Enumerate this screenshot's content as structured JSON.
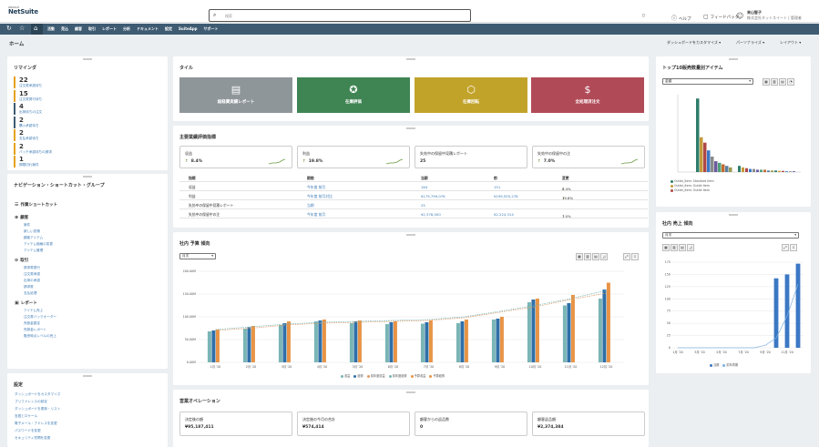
{
  "topbar": {
    "logo_small": "ORACLE",
    "logo": "NetSuite",
    "search_placeholder": "検索",
    "help": "ヘルプ",
    "feedback": "フィードバック",
    "user_name": "来山智子",
    "user_role": "株式会社ネットスイート | 管理者"
  },
  "nav": {
    "items": [
      "活動",
      "見込",
      "顧客",
      "取引",
      "レポート",
      "分析",
      "ドキュメント",
      "設定",
      "SuiteApp",
      "サポート"
    ]
  },
  "page": {
    "title": "ホーム",
    "controls": [
      "ダッシュボードをカスタマイズ",
      "パーソナライズ",
      "レイアウト"
    ]
  },
  "reminders": {
    "title": "リマインダ",
    "items": [
      {
        "count": "22",
        "label": "注文書承認待ち",
        "color": "orange"
      },
      {
        "count": "15",
        "label": "注文書発行待ち",
        "color": "orange"
      },
      {
        "count": "4",
        "label": "出荷待ちの注文",
        "color": "blue"
      },
      {
        "count": "2",
        "label": "購入承認待ち",
        "color": "blue"
      },
      {
        "count": "2",
        "label": "支払承認待ち",
        "color": "orange"
      },
      {
        "count": "2",
        "label": "バッチ承認待ちの請求",
        "color": "orange"
      },
      {
        "count": "1",
        "label": "期限切れ案件",
        "color": "orange"
      }
    ]
  },
  "navgroup": {
    "title": "ナビゲーション・ショートカット・グループ",
    "header": "作業ショートカット",
    "sections": [
      {
        "label": "顧客",
        "links": [
          "案件",
          "新しい見積",
          "顧客アイテム",
          "アイテム価格の変更",
          "アイテム管理"
        ]
      },
      {
        "label": "取引",
        "links": [
          "請求書発行",
          "注文書承認",
          "出荷の承認",
          "請求書",
          "支払処理"
        ]
      },
      {
        "label": "レポート",
        "links": [
          "アイテム売上",
          "注文書バックオーダー",
          "売掛金勘定",
          "売掛金レポート",
          "販売時点レベルの売上"
        ]
      }
    ]
  },
  "settings": {
    "title": "設定",
    "links": [
      "ダッシュボードをカスタマイズ",
      "プリファレンスの設定",
      "ダッシュボードを更新・リスト",
      "言語とロケール",
      "電子メール・アドレスを変更",
      "パスワードを変更",
      "セキュリティ質問を変更"
    ]
  },
  "tiles": {
    "title": "タイル",
    "items": [
      {
        "label": "総経費実績レポート",
        "color": "#8f969a"
      },
      {
        "label": "在庫評価",
        "color": "#3f8554"
      },
      {
        "label": "在庫回転",
        "color": "#c2a32a"
      },
      {
        "label": "全処理済注文",
        "color": "#b14a57"
      }
    ]
  },
  "kpis": {
    "title": "主要業績評価指標",
    "cards": [
      {
        "label": "収益",
        "value": "8.4%"
      },
      {
        "label": "利益",
        "value": "19.8%"
      },
      {
        "label": "失効中の保留中見積レポート",
        "value": "25"
      },
      {
        "label": "失効中の保留中の注",
        "value": "7.0%"
      }
    ],
    "columns": [
      "指標",
      "期間",
      "当期",
      "前",
      "変更"
    ],
    "rows": [
      {
        "name": "収益",
        "period": "今年度 前月",
        "cur": "164",
        "prev": "151",
        "change": "8.4%",
        "arrow": "↑"
      },
      {
        "name": "利益",
        "period": "今年度 前月対比",
        "cur": "¥179,799,076",
        "prev": "¥199,555,278",
        "change": "19.8%",
        "arrow": "↑"
      },
      {
        "name": "失効中の保留中見積レポート",
        "period": "当期",
        "cur": "25",
        "prev": "",
        "change": "",
        "arrow": ""
      },
      {
        "name": "失効中の保留中の注",
        "period": "今年度 前月",
        "cur": "¥2,378,000",
        "prev": "¥2,224,314",
        "change": "7.0%",
        "arrow": "↑"
      }
    ]
  },
  "trend_chart": {
    "title": "社内 予算 傾向",
    "select": "月次",
    "legend": [
      "収益",
      "経費",
      "前年度収益",
      "前年度経費",
      "予算収益",
      "予算経費"
    ]
  },
  "ops": {
    "title": "営業オペレーション",
    "cards": [
      {
        "label": "決定後の額",
        "value": "¥95,187,411"
      },
      {
        "label": "決定後の今月の合計",
        "value": "¥574,414"
      },
      {
        "label": "顧客からの返品数",
        "value": "0"
      },
      {
        "label": "顧客返品額",
        "value": "¥2,374,384"
      }
    ]
  },
  "top_items": {
    "title": "トップ10販売数量別アイテム",
    "select": "金額",
    "legend": [
      "Outlet_Item: Standard Item",
      "Outlet_Item: Outlet Item",
      "Outlet_Item: Outlet Item"
    ]
  },
  "sales_trend": {
    "title": "社内 売上 傾向",
    "select": "月次",
    "legend": [
      "当期",
      "前年同期"
    ]
  },
  "colors": {
    "nav": "#3e5b72",
    "accent": "#e7a21f",
    "teal": "#7ab5b5",
    "blue": "#3b78c4",
    "orange": "#e89446"
  },
  "chart_data": [
    {
      "type": "bar",
      "title": "社内 予算 傾向",
      "categories": [
        "1月 '20",
        "2月 '20",
        "3月 '20",
        "4月 '20",
        "5月 '20",
        "6月 '20",
        "7月 '20",
        "8月 '20",
        "9月 '20",
        "10月 '20",
        "11月 '20",
        "12月 '20"
      ],
      "yticks": [
        "0.00M",
        "50.00M",
        "100.00M",
        "150.00M",
        "200.00M"
      ],
      "ylim": [
        0,
        200
      ],
      "series": [
        {
          "name": "収益",
          "color": "#7ab5b5",
          "values": [
            68,
            74,
            82,
            90,
            86,
            84,
            85,
            86,
            94,
            132,
            125,
            140
          ]
        },
        {
          "name": "経費",
          "color": "#2f6fa8",
          "values": [
            70,
            77,
            86,
            92,
            90,
            88,
            88,
            90,
            96,
            138,
            130,
            160
          ]
        },
        {
          "name": "予算収益",
          "color": "#e89446",
          "values": [
            72,
            80,
            90,
            94,
            92,
            90,
            92,
            94,
            100,
            140,
            148,
            175
          ]
        }
      ],
      "lines": [
        {
          "name": "前年度収益",
          "color": "#dc9a65",
          "values": [
            70,
            75,
            82,
            86,
            88,
            90,
            92,
            98,
            110,
            122,
            138,
            152
          ]
        },
        {
          "name": "前年度経費",
          "color": "#7ab5b5",
          "values": [
            72,
            78,
            84,
            88,
            90,
            92,
            94,
            100,
            112,
            125,
            140,
            158
          ]
        }
      ]
    },
    {
      "type": "bar",
      "title": "トップ10販売数量別アイテム",
      "ylim": [
        0,
        100
      ],
      "series": [
        {
          "color": "#2e7d6a",
          "values": [
            95
          ]
        },
        {
          "color": "#c49a3a",
          "values": [
            45
          ]
        },
        {
          "color": "#b04848",
          "values": [
            38
          ]
        },
        {
          "color": "#3b78c4",
          "values": [
            28
          ]
        },
        {
          "color": "#8a8a8a",
          "values": [
            20
          ]
        },
        {
          "color": "#6b5aa0",
          "values": [
            14
          ]
        },
        {
          "color": "#4fa07a",
          "values": [
            12
          ]
        },
        {
          "color": "#c06a30",
          "values": [
            10
          ]
        },
        {
          "color": "#5a7fa0",
          "values": [
            8
          ]
        },
        {
          "color": "#9a9a50",
          "values": [
            6
          ]
        }
      ]
    },
    {
      "type": "bar",
      "title": "社内 売上 傾向",
      "categories": [
        "1月 '20",
        "2月 '20",
        "3月 '20",
        "4月 '20",
        "5月 '20",
        "6月 '20",
        "7月 '20",
        "8月 '20",
        "9月 '20",
        "10月 '20",
        "11月 '20",
        "12月 '20"
      ],
      "yticks": [
        "0",
        "25",
        "50",
        "75",
        "100",
        "125",
        "150",
        "175"
      ],
      "ylim": [
        0,
        175
      ],
      "series": [
        {
          "name": "当期",
          "color": "#3b78c4",
          "values": [
            0,
            0,
            0,
            0,
            0,
            0,
            0,
            0,
            0,
            142,
            150,
            172
          ]
        }
      ],
      "lines": [
        {
          "name": "前年同期",
          "color": "#7fb0e0",
          "values": [
            0,
            0,
            0,
            0,
            0,
            0,
            0,
            0,
            5,
            20,
            65,
            130
          ]
        }
      ]
    }
  ]
}
